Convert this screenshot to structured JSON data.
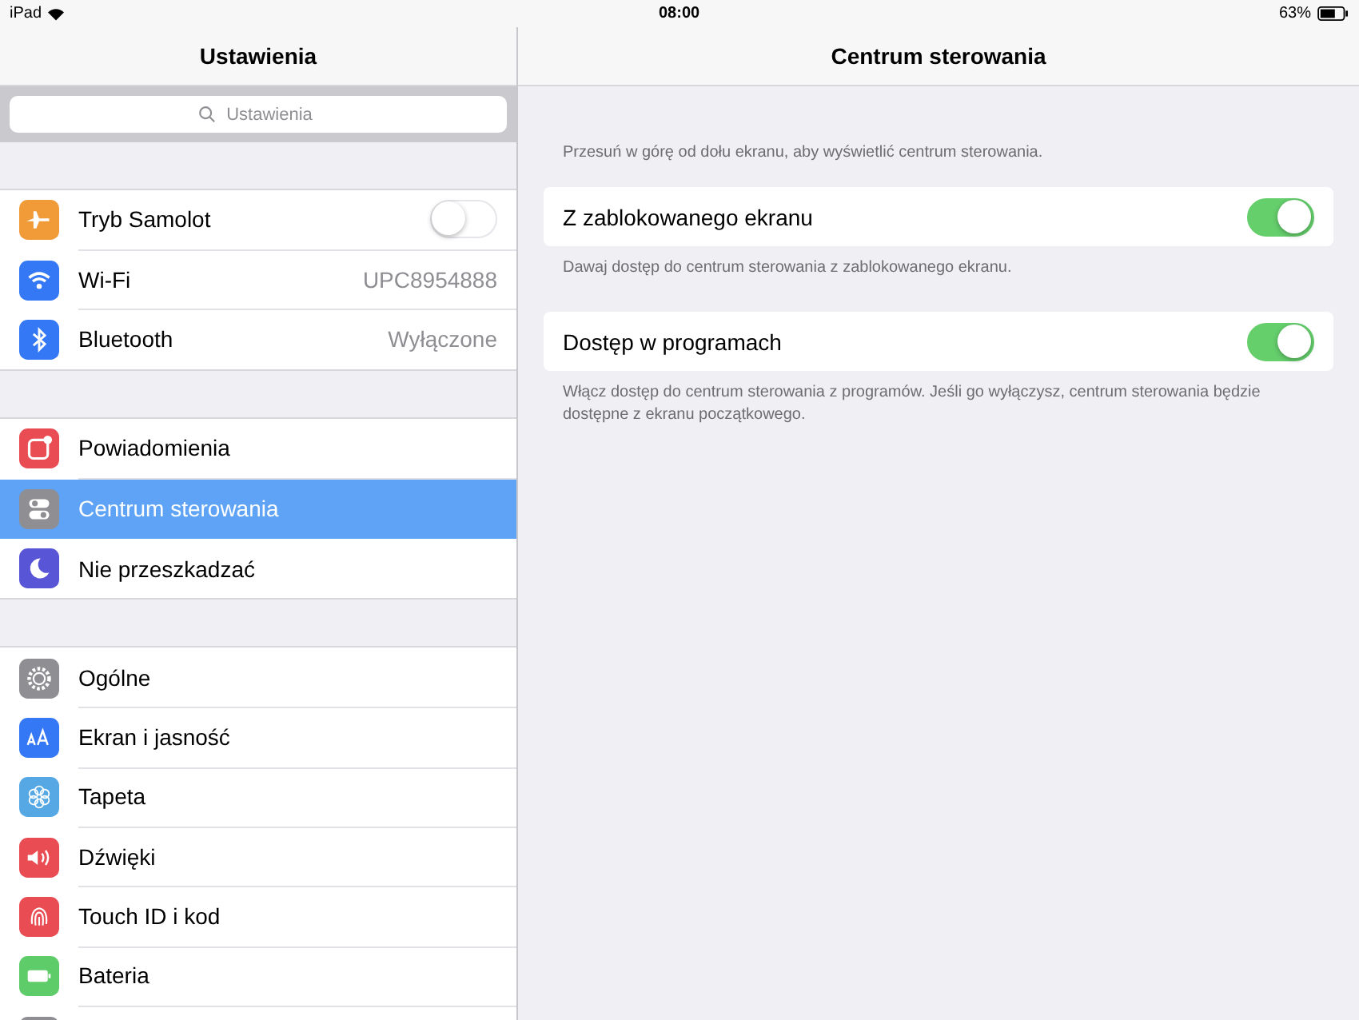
{
  "status_bar": {
    "device": "iPad",
    "time": "08:00",
    "battery": "63%"
  },
  "sidebar": {
    "title": "Ustawienia",
    "search": {
      "placeholder": "Ustawienia"
    },
    "groups": [
      {
        "items": [
          {
            "label": "Tryb Samolot",
            "color": "#f19a38",
            "kind": "toggle",
            "on": false,
            "selected": false
          },
          {
            "label": "Wi-Fi",
            "color": "#3478f6",
            "kind": "value",
            "value": "UPC8954888",
            "selected": false
          },
          {
            "label": "Bluetooth",
            "color": "#3478f6",
            "kind": "value",
            "value": "Wyłączone",
            "selected": false
          }
        ]
      },
      {
        "items": [
          {
            "label": "Powiadomienia",
            "color": "#ea4c53",
            "kind": "link",
            "selected": false
          },
          {
            "label": "Centrum sterowania",
            "color": "#8e8e93",
            "kind": "link",
            "selected": true
          },
          {
            "label": "Nie przeszkadzać",
            "color": "#5856d6",
            "kind": "link",
            "selected": false
          }
        ]
      },
      {
        "items": [
          {
            "label": "Ogólne",
            "color": "#8e8e93",
            "kind": "link",
            "selected": false
          },
          {
            "label": "Ekran i jasność",
            "color": "#3478f6",
            "kind": "link",
            "selected": false
          },
          {
            "label": "Tapeta",
            "color": "#55a8e4",
            "kind": "link",
            "selected": false
          },
          {
            "label": "Dźwięki",
            "color": "#ea4c53",
            "kind": "link",
            "selected": false
          },
          {
            "label": "Touch ID i kod",
            "color": "#ea4c53",
            "kind": "link",
            "selected": false
          },
          {
            "label": "Bateria",
            "color": "#5fcc6a",
            "kind": "link",
            "selected": false
          },
          {
            "color": "#8e8e93",
            "kind": "link",
            "selected": false
          }
        ]
      }
    ]
  },
  "detail": {
    "title": "Centrum sterowania",
    "intro": "Przesuń w górę od dołu ekranu, aby wyświetlić centrum sterowania.",
    "settings": [
      {
        "label": "Z zablokowanego ekranu",
        "on": true,
        "footer": "Dawaj dostęp do centrum sterowania z zablokowanego ekranu."
      },
      {
        "label": "Dostęp w programach",
        "on": true,
        "footer": "Włącz dostęp do centrum sterowania z programów. Jeśli go wyłączysz, centrum sterowania będzie dostępne z ekranu początkowego."
      }
    ]
  }
}
